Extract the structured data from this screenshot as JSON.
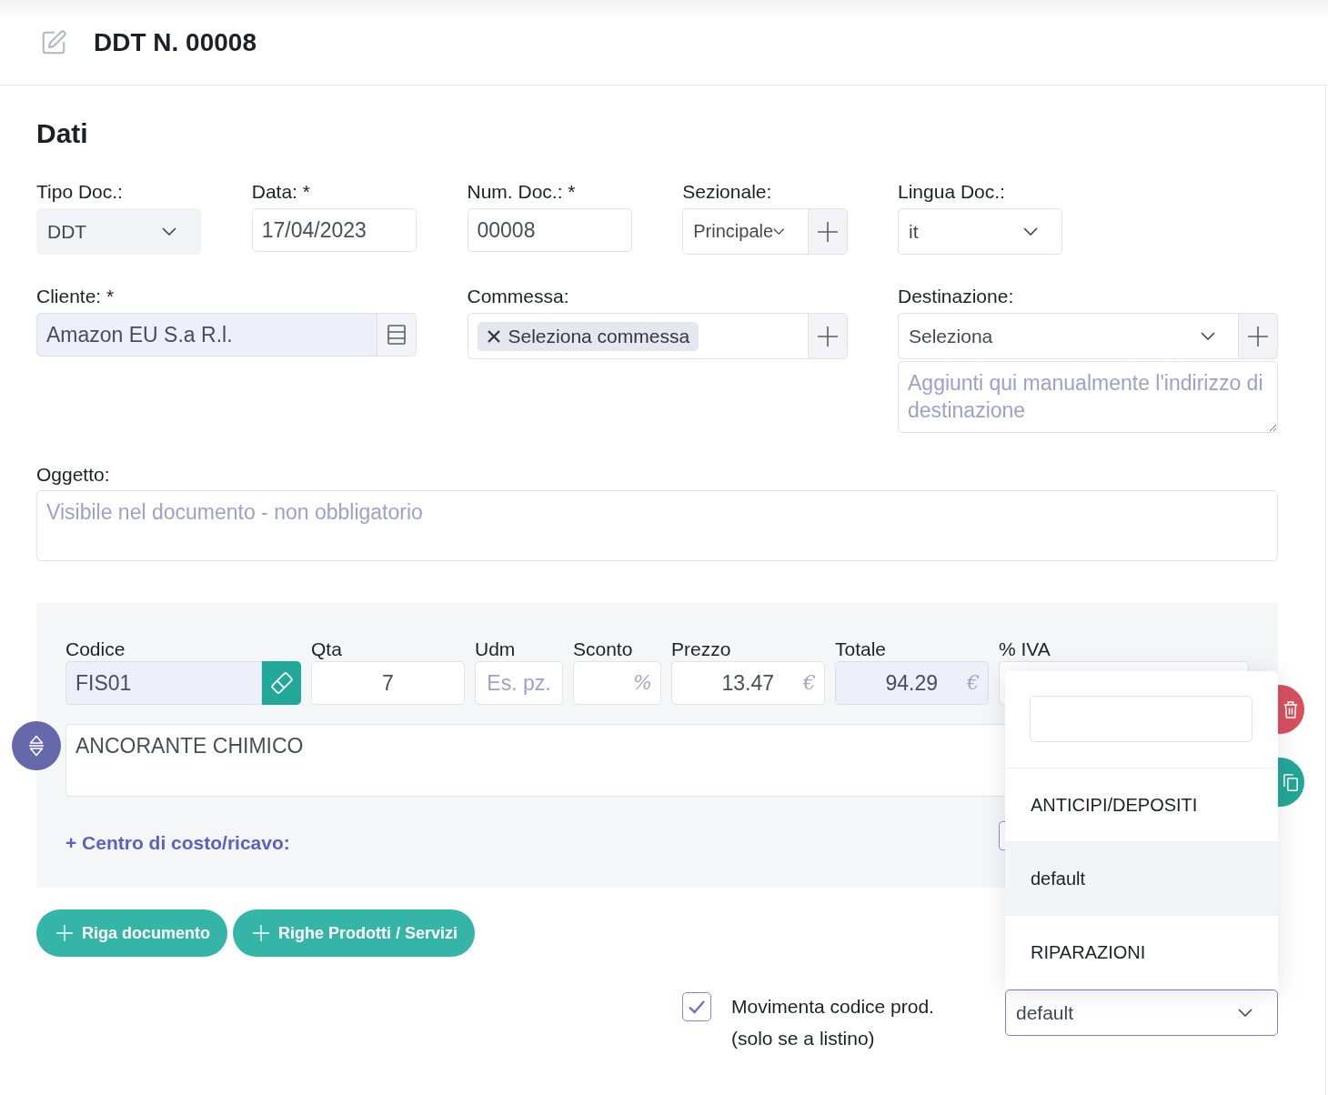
{
  "header": {
    "title": "DDT N. 00008"
  },
  "section": {
    "heading": "Dati"
  },
  "top_fields": [
    {
      "kind": "select",
      "label": "Tipo Doc.:",
      "value": "DDT",
      "disabled": true
    },
    {
      "kind": "input",
      "label": "Data: *",
      "value": "17/04/2023",
      "disabled": false
    },
    {
      "kind": "input",
      "label": "Num. Doc.: *",
      "value": "00008",
      "disabled": false
    },
    {
      "kind": "select_add",
      "label": "Sezionale:",
      "value": "Principale",
      "disabled": false
    },
    {
      "kind": "select",
      "label": "Lingua Doc.:",
      "value": "it",
      "disabled": false
    }
  ],
  "party_fields": [
    {
      "kind": "lookup",
      "label": "Cliente: *",
      "value": "Amazon EU S.a R.l.",
      "disabled": true
    },
    {
      "kind": "tags_add",
      "label": "Commessa:",
      "tags": [
        "Seleziona commessa"
      ]
    },
    {
      "kind": "select_add",
      "label": "Destinazione:",
      "value": "Seleziona",
      "disabled": false,
      "address": {
        "placeholder": "Aggiunti qui manualmente l'indirizzo di destinazione"
      }
    }
  ],
  "subject": {
    "label": "Oggetto:",
    "placeholder": "Visibile nel documento - non obbligatorio"
  },
  "line_items": [
    {
      "fields": [
        {
          "kind": "code",
          "label": "Codice",
          "value": "FIS01",
          "disabled": true
        },
        {
          "kind": "quantity",
          "label": "Qta",
          "value": "7",
          "disabled": false
        },
        {
          "kind": "unit",
          "label": "Udm",
          "placeholder": "Es. pz.",
          "disabled": false
        },
        {
          "kind": "percent",
          "label": "Sconto",
          "suffix": "%",
          "disabled": false
        },
        {
          "kind": "amount",
          "label": "Prezzo",
          "value": "13.47",
          "suffix": "€",
          "disabled": false
        },
        {
          "kind": "amount",
          "label": "Totale",
          "value": "94.29",
          "suffix": "€",
          "disabled": true
        },
        {
          "kind": "vat",
          "label": "% IVA",
          "disabled": false
        }
      ],
      "description": "ANCORANTE CHIMICO",
      "cost_center_link": "+ Centro di costo/ricavo:"
    }
  ],
  "add_buttons": [
    {
      "label": "Riga documento"
    },
    {
      "label": "Righe Prodotti / Servizi"
    }
  ],
  "stock_option": {
    "label": "Movimenta codice prod. (solo se a listino)",
    "checked": true
  },
  "dropdown_select": {
    "value": "default",
    "expanded": true,
    "options": [
      {
        "label": "ANTICIPI/DEPOSITI",
        "selected": false
      },
      {
        "label": "default",
        "selected": true
      },
      {
        "label": "RIPARAZIONI",
        "selected": false
      }
    ]
  }
}
